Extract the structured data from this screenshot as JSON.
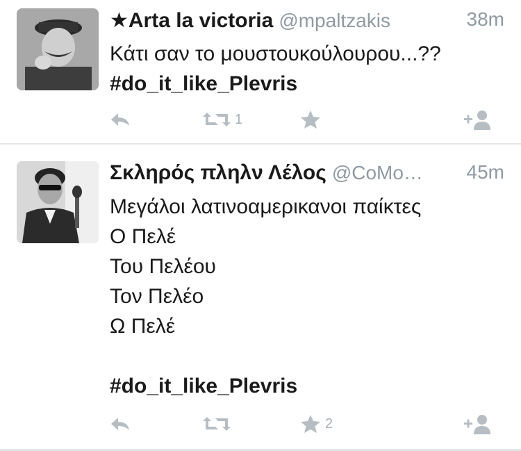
{
  "tweets": [
    {
      "name": "★Arta la victoria",
      "handle": "@mpaltzakis",
      "time": "38m",
      "lines": [
        "Κάτι σαν το μουστουκούλουρου...??"
      ],
      "hashtag": "#do_it_like_Plevris",
      "retweet_count": "1",
      "favorite_count": "",
      "icons": [
        "reply-icon",
        "retweet-icon",
        "favorite-icon",
        "follow-icon"
      ]
    },
    {
      "name": "Σκληρός πληλν Λέλος",
      "handle": "@CoMo…",
      "time": "45m",
      "lines": [
        "Μεγάλοι λατινοαμερικανοι παίκτες",
        "Ο Πελέ",
        "Του Πελέου",
        "Τον Πελέο",
        "Ω Πελέ",
        ""
      ],
      "hashtag": "#do_it_like_Plevris",
      "retweet_count": "",
      "favorite_count": "2",
      "icons": [
        "reply-icon",
        "retweet-icon",
        "favorite-icon",
        "follow-icon"
      ]
    }
  ],
  "colors": {
    "text": "#1a1a1a",
    "secondary": "#8f9aa3",
    "action_icon": "#b6bec4",
    "divider": "#e3e6e8"
  }
}
